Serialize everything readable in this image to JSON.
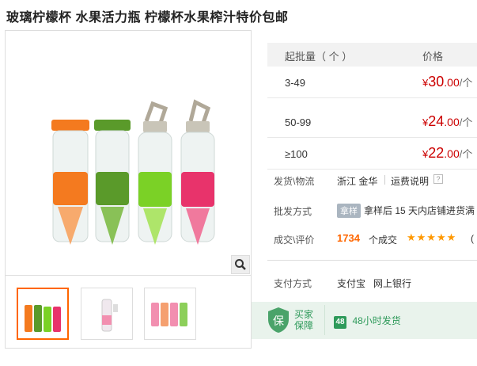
{
  "title": "玻璃柠檬杯 水果活力瓶 柠檬杯水果榨汁特价包邮",
  "price_table": {
    "header_qty": "起批量（ 个 ）",
    "header_price": "价格",
    "rows": [
      {
        "qty": "3-49",
        "currency": "¥",
        "int": "30",
        "dec": ".00",
        "unit": "/个"
      },
      {
        "qty": "50-99",
        "currency": "¥",
        "int": "24",
        "dec": ".00",
        "unit": "/个"
      },
      {
        "qty": "≥100",
        "currency": "¥",
        "int": "22",
        "dec": ".00",
        "unit": "/个"
      }
    ]
  },
  "shipping": {
    "label": "发货\\物流",
    "location": "浙江 金华",
    "fee_link": "运费说明",
    "help": "?"
  },
  "wholesale": {
    "label": "批发方式",
    "badge": "拿样",
    "text": "拿样后 15 天内店铺进货满"
  },
  "deal": {
    "label": "成交\\评价",
    "count": "1734",
    "count_suffix": "个成交",
    "stars": "★★★★★",
    "rating_count": "("
  },
  "payment": {
    "label": "支付方式",
    "methods": [
      "支付宝",
      "网上银行"
    ]
  },
  "guarantee": {
    "shield_char": "保",
    "line1": "买家",
    "line2": "保障",
    "badge": "48",
    "text": "48小时发货"
  },
  "colors": {
    "price_red": "#c00",
    "count_orange": "#f60",
    "star": "#f90",
    "guarantee_green": "#2e9a5a"
  }
}
